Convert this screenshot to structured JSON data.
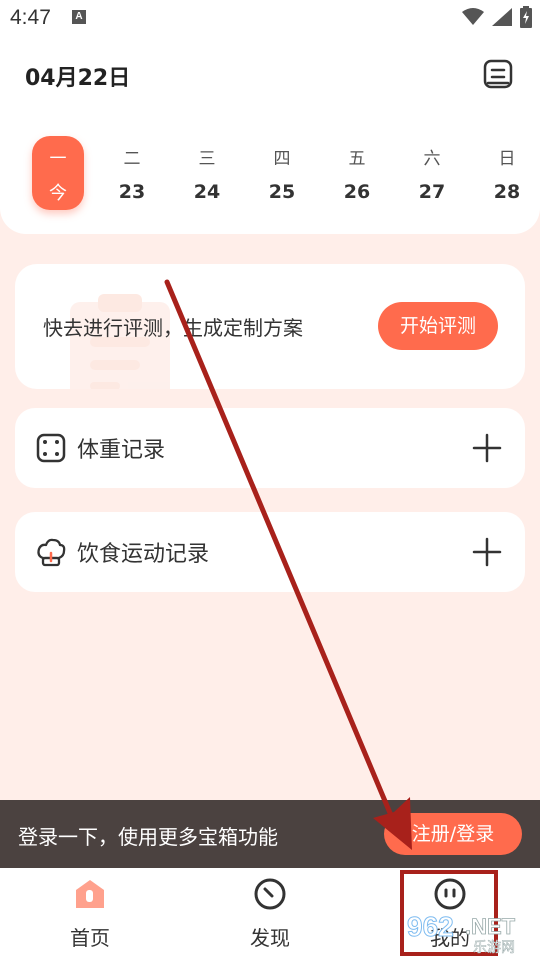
{
  "status_bar": {
    "time": "4:47",
    "keyboard_badge": "A"
  },
  "header": {
    "date": "04月22日",
    "calendar_icon": "calendar-list-icon"
  },
  "week": [
    {
      "dow": "一",
      "num": "今",
      "today": true
    },
    {
      "dow": "二",
      "num": "23"
    },
    {
      "dow": "三",
      "num": "24"
    },
    {
      "dow": "四",
      "num": "25"
    },
    {
      "dow": "五",
      "num": "26"
    },
    {
      "dow": "六",
      "num": "27"
    },
    {
      "dow": "日",
      "num": "28"
    }
  ],
  "assessment": {
    "text": "快去进行评测，生成定制方案",
    "button": "开始评测"
  },
  "records": [
    {
      "label": "体重记录",
      "icon": "scale-icon"
    },
    {
      "label": "饮食运动记录",
      "icon": "chef-hat-icon"
    }
  ],
  "login_banner": {
    "text": "登录一下，使用更多宝箱功能",
    "button": "注册/登录"
  },
  "nav": [
    {
      "label": "首页",
      "icon": "home-icon"
    },
    {
      "label": "发现",
      "icon": "discover-icon"
    },
    {
      "label": "我的",
      "icon": "profile-face-icon"
    }
  ],
  "watermark": {
    "brand": "962",
    "suffix": ".NET",
    "subtitle": "乐游网"
  },
  "colors": {
    "accent": "#ff6b4d",
    "background": "#ffeee9",
    "banner": "#4b4240",
    "annotation": "#a8211b"
  }
}
